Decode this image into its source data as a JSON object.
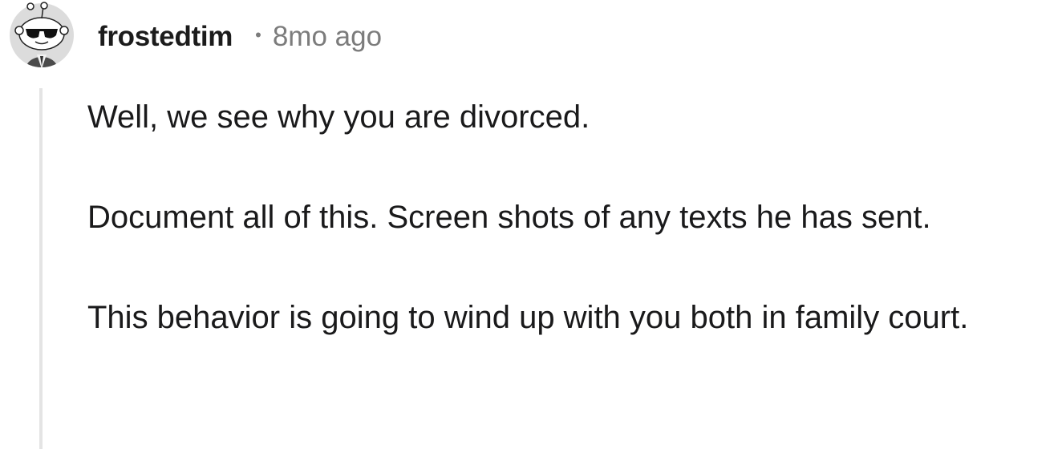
{
  "comment": {
    "username": "frostedtim",
    "separator": "•",
    "timestamp": "8mo ago",
    "avatar_icon": "reddit-snoo-sunglasses-avatar-icon",
    "paragraphs": [
      "Well, we see why you are divorced.",
      "Document all of this. Screen shots of any texts he has sent.",
      "This behavior is going to wind up with you both in family court."
    ]
  },
  "colors": {
    "username": "#1c1c1c",
    "meta": "#7c7c7c",
    "thread_line": "#e4e4e4",
    "text": "#1a1a1b"
  }
}
